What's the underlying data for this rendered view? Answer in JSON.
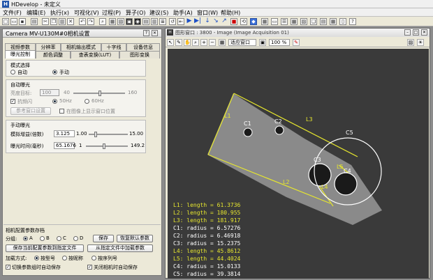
{
  "app": {
    "title": "HDevelop - 未定义"
  },
  "menu": [
    "文件(F)",
    "编辑(E)",
    "执行(x)",
    "可视化(V)",
    "过程(P)",
    "算子(O)",
    "建议(S)",
    "助手(A)",
    "窗口(W)",
    "帮助(H)"
  ],
  "camera_dialog": {
    "title": "Camera MV-U130M#0相机设置",
    "tabs_row1": [
      "视频参数",
      "分辨率",
      "相机输出模式",
      "十字线",
      "设备信息"
    ],
    "tabs_row2": [
      "曝光控制",
      "颜色调整",
      "查表变换(LUT)",
      "图形变换"
    ],
    "mode_group": {
      "title": "模式选择",
      "auto": "自动",
      "manual": "手动"
    },
    "auto_exposure": {
      "title": "自动曝光",
      "target_label": "亮度目标:",
      "target_value": "100",
      "min": "40",
      "max": "160",
      "antiflicker": "抗频闪",
      "hz50": "50Hz",
      "hz60": "60Hz",
      "ref_window_btn": "参考窗口设置",
      "show_ref_window": "在图像上显示窗口位置"
    },
    "manual_exposure": {
      "title": "手动曝光",
      "gain_label": "模拟增益(倍数)",
      "gain_value": "3.125",
      "gain_min": "1.00",
      "gain_max": "15.00",
      "gain_level": 0.16,
      "time_label": "曝光时间(毫秒)",
      "time_value": "65.1676",
      "time_min": "1",
      "time_max": "149.2",
      "time_level": 0.43
    },
    "param_save": {
      "title": "相机配置参数存档",
      "group_label": "分组:",
      "groups": [
        "A",
        "B",
        "C",
        "D"
      ],
      "save_btn": "保存",
      "restore_btn": "恢复默认参数",
      "save_to_file_btn": "保存当前配置参数到指定文件",
      "load_from_file_btn": "从指定文件中加载参数",
      "load_mode_label": "加载方式:",
      "load_opt1": "按型号",
      "load_opt2": "按昵称",
      "load_opt3": "按序列号",
      "auto_save_switch": "切换参数组时自动保存",
      "auto_save_close": "关闭相机时自动保存"
    }
  },
  "graphics_window": {
    "title": "图形窗口 : 3800 - Image (Image Acquisition 01)",
    "fit_label": "适应窗口",
    "zoom": "100 %",
    "colors": {
      "yellow": "#e6e62e",
      "white": "#ffffff",
      "bg": "#3a3a3a"
    },
    "shape_labels": [
      "L1",
      "C1",
      "C2",
      "L3",
      "C3",
      "C5",
      "L5",
      "C4",
      "L4",
      "L2"
    ],
    "results": [
      {
        "name": "L1",
        "metric": "length",
        "value": "61.3736",
        "color": "#e6e62e"
      },
      {
        "name": "L2",
        "metric": "length",
        "value": "180.955",
        "color": "#e6e62e"
      },
      {
        "name": "L3",
        "metric": "length",
        "value": "181.917",
        "color": "#e6e62e"
      },
      {
        "name": "C1",
        "metric": "radius",
        "value": "6.57276",
        "color": "#ffffff"
      },
      {
        "name": "C2",
        "metric": "radius",
        "value": "6.46918",
        "color": "#ffffff"
      },
      {
        "name": "C3",
        "metric": "radius",
        "value": "15.2375",
        "color": "#ffffff"
      },
      {
        "name": "L4",
        "metric": "length",
        "value": "45.8612",
        "color": "#e6e62e"
      },
      {
        "name": "L5",
        "metric": "length",
        "value": "44.4024",
        "color": "#e6e62e"
      },
      {
        "name": "C4",
        "metric": "radius",
        "value": "15.0133",
        "color": "#ffffff"
      },
      {
        "name": "C5",
        "metric": "radius",
        "value": "39.3814",
        "color": "#ffffff"
      }
    ]
  }
}
